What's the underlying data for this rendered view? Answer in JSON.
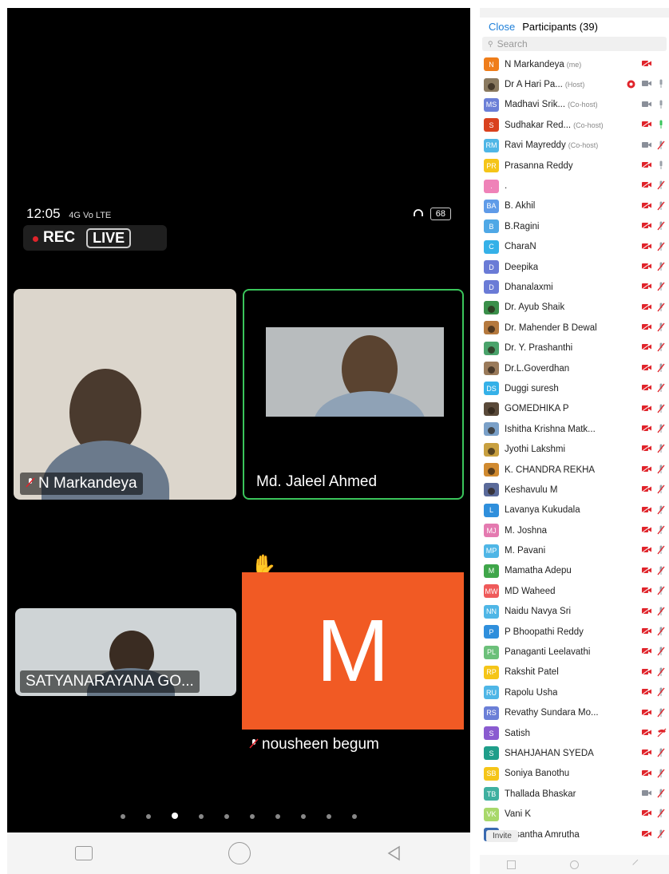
{
  "meeting": {
    "status_time": "12:05",
    "status_signal": "4G Vo LTE",
    "battery": "68",
    "rec_label": "REC",
    "live_label": "LIVE",
    "tiles": [
      {
        "name": "N Markandeya",
        "muted": true
      },
      {
        "name": "Md. Jaleel Ahmed",
        "muted": false,
        "active_speaker": true
      },
      {
        "name": "SATYANARAYANA GO...",
        "muted": false
      },
      {
        "name": "nousheen begum",
        "muted": true,
        "hand_raised": true,
        "initial": "M",
        "color": "#f15a24"
      }
    ],
    "page_dots": 10,
    "current_page_index": 2
  },
  "panel": {
    "close_label": "Close",
    "title": "Participants (39)",
    "search_placeholder": "Search",
    "invite_label": "Invite",
    "participants": [
      {
        "initials": "N",
        "name": "N Markandeya",
        "role": "(me)",
        "color": "#ef7d1a",
        "video": "off",
        "mic": "none"
      },
      {
        "initials": "",
        "name": "Dr A Hari Pa...",
        "role": "(Host)",
        "color": "#8a7a60",
        "photo": true,
        "video": "on",
        "mic": "gray",
        "recording": true
      },
      {
        "initials": "MS",
        "name": "Madhavi Srik...",
        "role": "(Co-host)",
        "color": "#6b7fd7",
        "video": "on",
        "mic": "gray"
      },
      {
        "initials": "S",
        "name": "Sudhakar Red...",
        "role": "(Co-host)",
        "color": "#d9411e",
        "video": "off",
        "mic": "green"
      },
      {
        "initials": "RM",
        "name": "Ravi Mayreddy",
        "role": "(Co-host)",
        "color": "#4fb6e6",
        "video": "on",
        "mic": "muted"
      },
      {
        "initials": "PR",
        "name": "Prasanna Reddy",
        "role": "",
        "color": "#f5c518",
        "video": "off",
        "mic": "gray"
      },
      {
        "initials": ".",
        "name": ".",
        "role": "",
        "color": "#ef82b8",
        "video": "off",
        "mic": "muted"
      },
      {
        "initials": "BA",
        "name": "B. Akhil",
        "role": "",
        "color": "#5f9be8",
        "video": "off",
        "mic": "muted"
      },
      {
        "initials": "B",
        "name": "B.Ragini",
        "role": "",
        "color": "#4fa8e6",
        "video": "off",
        "mic": "muted"
      },
      {
        "initials": "C",
        "name": "CharaN",
        "role": "",
        "color": "#35b1e8",
        "video": "off",
        "mic": "muted"
      },
      {
        "initials": "D",
        "name": "Deepika",
        "role": "",
        "color": "#6a7bd6",
        "video": "off",
        "mic": "muted"
      },
      {
        "initials": "D",
        "name": "Dhanalaxmi",
        "role": "",
        "color": "#6a7bd6",
        "video": "off",
        "mic": "muted"
      },
      {
        "initials": "",
        "name": "Dr. Ayub Shaik",
        "role": "",
        "color": "#3a8f4a",
        "photo": true,
        "video": "off",
        "mic": "muted"
      },
      {
        "initials": "",
        "name": "Dr. Mahender B Dewal",
        "role": "",
        "color": "#b5793e",
        "photo": true,
        "video": "off",
        "mic": "muted"
      },
      {
        "initials": "",
        "name": "Dr. Y. Prashanthi",
        "role": "",
        "color": "#4aa36b",
        "photo": true,
        "video": "off",
        "mic": "muted"
      },
      {
        "initials": "",
        "name": "Dr.L.Goverdhan",
        "role": "",
        "color": "#9a7a5a",
        "photo": true,
        "video": "off",
        "mic": "muted"
      },
      {
        "initials": "DS",
        "name": "Duggi suresh",
        "role": "",
        "color": "#35b1e8",
        "video": "off",
        "mic": "muted"
      },
      {
        "initials": "",
        "name": "GOMEDHIKA P",
        "role": "",
        "color": "#5a4a3a",
        "photo": true,
        "video": "off",
        "mic": "muted"
      },
      {
        "initials": "",
        "name": "Ishitha Krishna Matk...",
        "role": "",
        "color": "#7aa0c8",
        "photo": true,
        "video": "off",
        "mic": "muted"
      },
      {
        "initials": "",
        "name": "Jyothi Lakshmi",
        "role": "",
        "color": "#c8a040",
        "photo": true,
        "video": "off",
        "mic": "muted"
      },
      {
        "initials": "",
        "name": "K. CHANDRA REKHA",
        "role": "",
        "color": "#d08a30",
        "photo": true,
        "video": "off",
        "mic": "muted"
      },
      {
        "initials": "",
        "name": "Keshavulu M",
        "role": "",
        "color": "#5a6a9a",
        "photo": true,
        "video": "off",
        "mic": "muted"
      },
      {
        "initials": "L",
        "name": "Lavanya Kukudala",
        "role": "",
        "color": "#2f8fdc",
        "video": "off",
        "mic": "muted"
      },
      {
        "initials": "MJ",
        "name": "M. Joshna",
        "role": "",
        "color": "#e47ab0",
        "video": "off",
        "mic": "muted"
      },
      {
        "initials": "MP",
        "name": "M. Pavani",
        "role": "",
        "color": "#4fb6e6",
        "video": "off",
        "mic": "muted"
      },
      {
        "initials": "M",
        "name": "Mamatha Adepu",
        "role": "",
        "color": "#3fa64a",
        "video": "off",
        "mic": "muted"
      },
      {
        "initials": "MW",
        "name": "MD Waheed",
        "role": "",
        "color": "#ef5a5a",
        "video": "off",
        "mic": "muted"
      },
      {
        "initials": "NN",
        "name": "Naidu Navya Sri",
        "role": "",
        "color": "#4fb6e6",
        "video": "off",
        "mic": "muted"
      },
      {
        "initials": "P",
        "name": "P Bhoopathi Reddy",
        "role": "",
        "color": "#2f8fdc",
        "video": "off",
        "mic": "muted"
      },
      {
        "initials": "PL",
        "name": "Panaganti Leelavathi",
        "role": "",
        "color": "#6cc07a",
        "video": "off",
        "mic": "muted"
      },
      {
        "initials": "RP",
        "name": "Rakshit Patel",
        "role": "",
        "color": "#f5c518",
        "video": "off",
        "mic": "muted"
      },
      {
        "initials": "RU",
        "name": "Rapolu Usha",
        "role": "",
        "color": "#4fb6e6",
        "video": "off",
        "mic": "muted"
      },
      {
        "initials": "RS",
        "name": "Revathy Sundara Mo...",
        "role": "",
        "color": "#6b7fd7",
        "video": "off",
        "mic": "muted"
      },
      {
        "initials": "S",
        "name": "Satish",
        "role": "",
        "color": "#8a5bd0",
        "video": "off",
        "mic": "phone"
      },
      {
        "initials": "S",
        "name": "SHAHJAHAN SYEDA",
        "role": "",
        "color": "#1f9e8a",
        "video": "off",
        "mic": "muted"
      },
      {
        "initials": "SB",
        "name": "Soniya Banothu",
        "role": "",
        "color": "#f5c518",
        "video": "off",
        "mic": "muted"
      },
      {
        "initials": "TB",
        "name": "Thallada Bhaskar",
        "role": "",
        "color": "#3fb0a0",
        "video": "on",
        "mic": "muted"
      },
      {
        "initials": "VK",
        "name": "Vani K",
        "role": "",
        "color": "#a8d86a",
        "video": "off",
        "mic": "muted"
      },
      {
        "initials": "",
        "name": "Vasantha Amrutha",
        "role": "",
        "color": "#3a6ab0",
        "photo": true,
        "video": "off",
        "mic": "muted"
      }
    ]
  },
  "colors": {
    "zoom_blue": "#1e7fd8",
    "active_border": "#3ac55b",
    "muted_red": "#e0242b",
    "rec_red": "#e0242b"
  }
}
